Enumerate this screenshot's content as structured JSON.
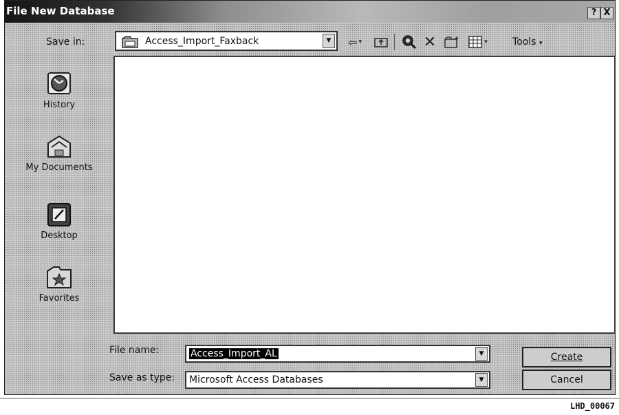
{
  "window": {
    "title": "File New Database",
    "help_btn": "?",
    "close_btn": "X"
  },
  "toolbar": {
    "save_in_label": "Save in:",
    "save_in_value": "Access_Import_Faxback",
    "tools_label": "Tools",
    "icons": [
      "back-icon",
      "up-folder-icon",
      "search-web-icon",
      "delete-icon",
      "new-folder-icon",
      "views-icon"
    ]
  },
  "sidebar": {
    "items": [
      {
        "label": "History",
        "icon": "history-icon"
      },
      {
        "label": "My Documents",
        "icon": "my-documents-icon"
      },
      {
        "label": "Desktop",
        "icon": "desktop-icon"
      },
      {
        "label": "Favorites",
        "icon": "favorites-icon"
      }
    ]
  },
  "form": {
    "file_name_label": "File name:",
    "file_name_value": "Access_Import_AL",
    "save_type_label": "Save as type:",
    "save_type_value": "Microsoft Access Databases"
  },
  "buttons": {
    "create": "Create",
    "cancel": "Cancel"
  },
  "footer": {
    "bates": "LHD_00067"
  }
}
